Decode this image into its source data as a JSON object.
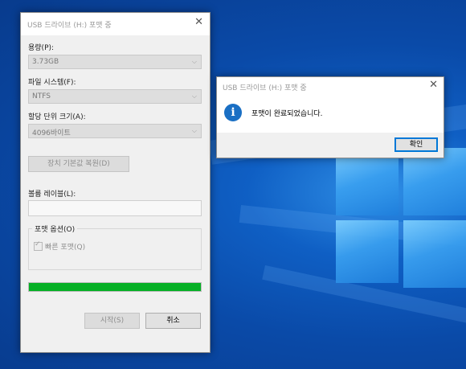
{
  "format_dialog": {
    "title": "USB 드라이브 (H:) 포맷 중",
    "capacity_label": "용량(P):",
    "capacity_value": "3.73GB",
    "filesystem_label": "파일 시스템(F):",
    "filesystem_value": "NTFS",
    "alloc_label": "할당 단위 크기(A):",
    "alloc_value": "4096바이트",
    "restore_defaults_label": "장치 기본값 복원(D)",
    "volume_label_label": "볼륨 레이블(L):",
    "volume_label_value": "",
    "format_options_label": "포맷 옵션(O)",
    "quick_format_label": "빠른 포맷(Q)",
    "quick_format_checked": true,
    "progress": 1.0,
    "start_label": "시작(S)",
    "cancel_label": "취소"
  },
  "message_box": {
    "title": "USB 드라이브 (H:) 포맷 중",
    "message": "포맷이 완료되었습니다.",
    "ok_label": "확인"
  },
  "icons": {
    "close": "close-icon",
    "dropdown": "chevron-down-icon",
    "info": "info-icon",
    "check": "checkmark-icon"
  },
  "colors": {
    "progress_fill": "#06b025",
    "desktop_blue": "#0a4aa8",
    "info_icon": "#1a6fc4",
    "default_button_border": "#0078d7"
  }
}
